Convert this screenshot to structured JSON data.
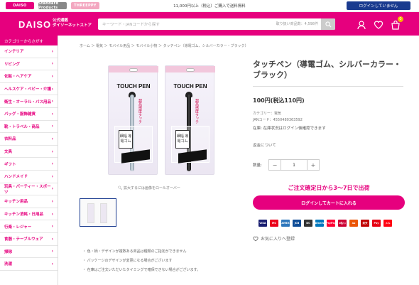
{
  "topbar": {
    "brands": [
      "DAISO",
      "Standard Products",
      "THREEPPY"
    ],
    "shipping_note": "11,000円以上（税込）ご購入で送料無料",
    "login_status": "ログインしていません"
  },
  "header": {
    "logo": "DAISO",
    "logo_sub_1": "公式通販",
    "logo_sub_2": "ダイソーネットストア",
    "search_placeholder": "キーワード・JANコードから探す",
    "search_scope": "取り扱い商品数：4,598件",
    "cart_count": "0",
    "accent": "#e6007e"
  },
  "sidebar": {
    "heading": "カテゴリーからさがす",
    "items": [
      "インテリア",
      "リビング",
      "化粧・ヘアケア",
      "ヘルスケア・ベビー・介護",
      "衛生・オーラル・バス用品",
      "バッグ・服飾雑貨",
      "靴・トラベル・商品",
      "衣料品",
      "文具",
      "ギフト",
      "ハンドメイド",
      "玩具・パーティー・スポーツ",
      "キッチン用品",
      "キッチン消耗・日用品",
      "行楽・レジャー",
      "食器・テーブルウェア",
      "掃除",
      "洗濯"
    ]
  },
  "breadcrumb": "ホーム ＞ 電気 ＞ モバイル用品 ＞ モバイル小物 ＞ タッチペン（導電ゴム、シルバーカラー・ブラック）",
  "gallery": {
    "pkg_title": "TOUCH PEN",
    "pkg_vertical": "超高感度タッチ",
    "pkg_label": "細幅\n導電ゴム",
    "zoom_hint": "拡大するには画像をロールオーバー"
  },
  "notes": [
    "色・柄・デザインが複数ある商品は種類のご指定ができません",
    "パッケージのデザインが変更になる場合がございます",
    "在庫はご注文いただいたタイミングで確保できない場合がございます。"
  ],
  "product": {
    "title": "タッチペン（導電ゴム、シルバーカラー・ブラック）",
    "price": "100円(税込110円)",
    "category": "カテゴリー：電気",
    "jan": "JANコード：4550480363592",
    "stock": "在庫:  在庫状況はログイン後確認できます",
    "return_label": "返金について",
    "qty_label": "数量:",
    "qty_minus": "−",
    "qty_value": "1",
    "qty_plus": "+",
    "ship_days": "ご注文確定日から3〜7日で出荷",
    "cart_button": "ログインしてカートに入れる",
    "favorite": "お気に入りへ登録"
  },
  "payments": [
    "VISA",
    "MC",
    "AMEX",
    "JCB",
    "DC",
    "Diners",
    "PayPay",
    "d払い",
    "au",
    "楽天",
    "Pay",
    "メル"
  ]
}
